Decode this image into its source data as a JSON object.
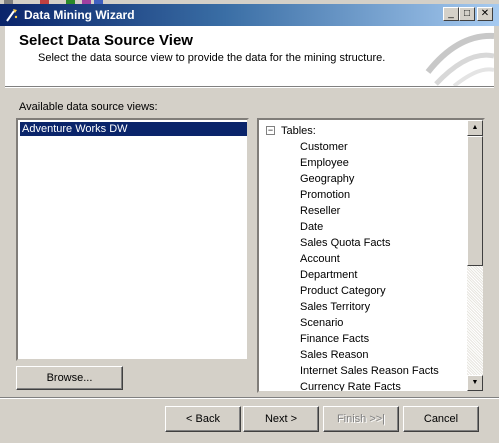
{
  "window": {
    "title": "Data Mining Wizard",
    "title_icon": "wizard-icon",
    "controls": {
      "minimize": "_",
      "maximize": "□",
      "close": "✕"
    }
  },
  "header": {
    "title": "Select Data Source View",
    "subtitle": "Select the data source view to provide the data for the mining structure."
  },
  "available_label": "Available data source views:",
  "data_source_views": [
    {
      "label": "Adventure Works DW",
      "selected": true
    }
  ],
  "tree": {
    "toggle": "⊟",
    "root_label": "Tables:",
    "items": [
      "Customer",
      "Employee",
      "Geography",
      "Promotion",
      "Reseller",
      "Date",
      "Sales Quota Facts",
      "Account",
      "Department",
      "Product Category",
      "Sales Territory",
      "Scenario",
      "Finance Facts",
      "Sales Reason",
      "Internet Sales Reason Facts",
      "Currency Rate Facts"
    ],
    "scroll_up": "▲",
    "scroll_down": "▼"
  },
  "buttons": {
    "browse": "Browse...",
    "back": "< Back",
    "next": "Next >",
    "finish": "Finish >>|",
    "cancel": "Cancel"
  },
  "colors": {
    "title_gradient_start": "#0a246a",
    "title_gradient_end": "#a6caf0",
    "dialog_face": "#d4d0c8",
    "selection": "#0a246a"
  }
}
